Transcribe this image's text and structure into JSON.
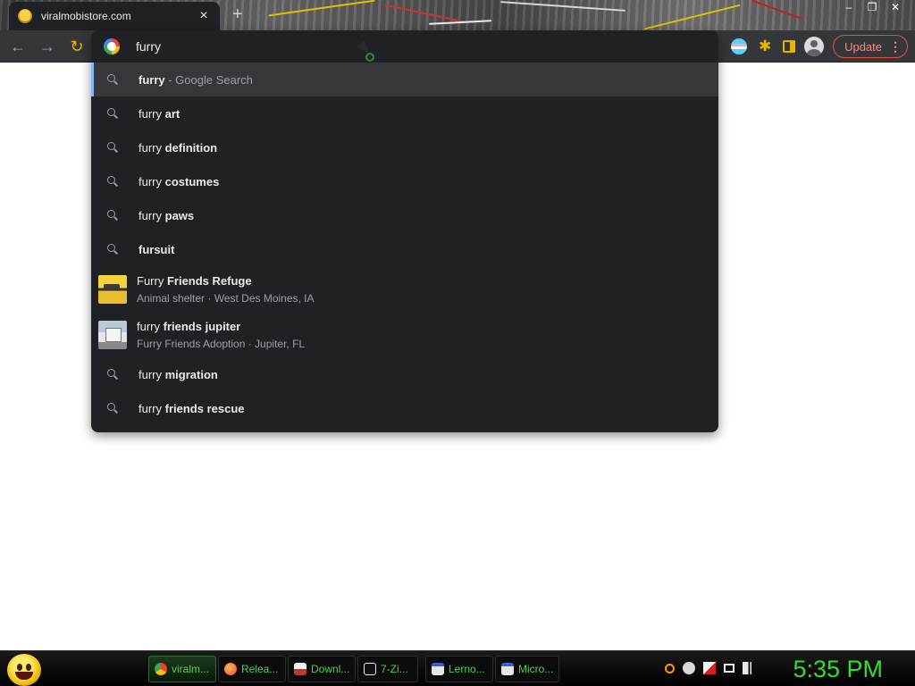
{
  "tab": {
    "title": "viralmobistore.com",
    "close_glyph": "×",
    "new_tab_glyph": "+"
  },
  "window_controls": {
    "minimize": "–",
    "restore": "❐",
    "close": "✕"
  },
  "toolbar": {
    "back_glyph": "←",
    "forward_glyph": "→",
    "reload_glyph": "↻",
    "puzzle_glyph": "✱",
    "update_label": "Update",
    "menu_glyph": "⋮"
  },
  "omnibox": {
    "text": "furry",
    "suggestions": [
      {
        "query": "furry",
        "bold": "",
        "suffix": " - Google Search"
      },
      {
        "query": "furry ",
        "bold": "art",
        "suffix": ""
      },
      {
        "query": "furry ",
        "bold": "definition",
        "suffix": ""
      },
      {
        "query": "furry ",
        "bold": "costumes",
        "suffix": ""
      },
      {
        "query": "furry ",
        "bold": "paws",
        "suffix": ""
      },
      {
        "query": "",
        "bold": "fursuit",
        "suffix": ""
      },
      {
        "query": "furry ",
        "bold": "migration",
        "suffix": ""
      },
      {
        "query": "furry ",
        "bold": "friends rescue",
        "suffix": ""
      }
    ],
    "entities": [
      {
        "title_plain": "Furry ",
        "title_bold": "Friends Refuge",
        "subtitle": "Animal shelter · West Des Moines, IA"
      },
      {
        "title_plain": "furry ",
        "title_bold": "friends jupiter",
        "subtitle": "Furry Friends Adoption · Jupiter, FL"
      }
    ]
  },
  "taskbar": {
    "tasks": [
      {
        "label": "viralm...",
        "icon_color": "#4285f4"
      },
      {
        "label": "Relea...",
        "icon_color": "#ff7139"
      },
      {
        "label": "Downl...",
        "icon_color": "#c0392b"
      },
      {
        "label": "7-Zi...",
        "icon_color": "#e8e8e8"
      },
      {
        "label": "Lerno...",
        "icon_color": "#d0d0d0"
      },
      {
        "label": "Micro...",
        "icon_color": "#d0d0d0"
      }
    ],
    "clock": "5:35 PM"
  },
  "colors": {
    "accent_green": "#2fe02f",
    "update_red": "#e35143",
    "selection_blue": "#8ab4f8"
  }
}
